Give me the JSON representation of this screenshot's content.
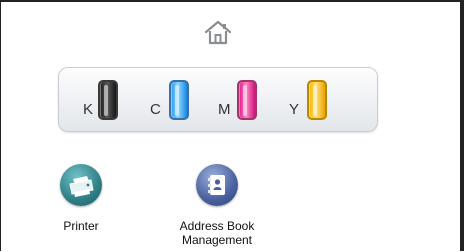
{
  "home": {
    "icon": "home-icon"
  },
  "toner": {
    "items": [
      {
        "letter": "K",
        "color": "#1a1a1a"
      },
      {
        "letter": "C",
        "color": "#2a9cf0"
      },
      {
        "letter": "M",
        "color": "#e0198a"
      },
      {
        "letter": "Y",
        "color": "#f7b500"
      }
    ]
  },
  "apps": [
    {
      "label": "Printer",
      "icon": "printer-icon",
      "color": "#2f7f86"
    },
    {
      "label_line1": "Address Book",
      "label_line2": "Management",
      "icon": "address-book-icon",
      "color": "#49609e"
    }
  ]
}
